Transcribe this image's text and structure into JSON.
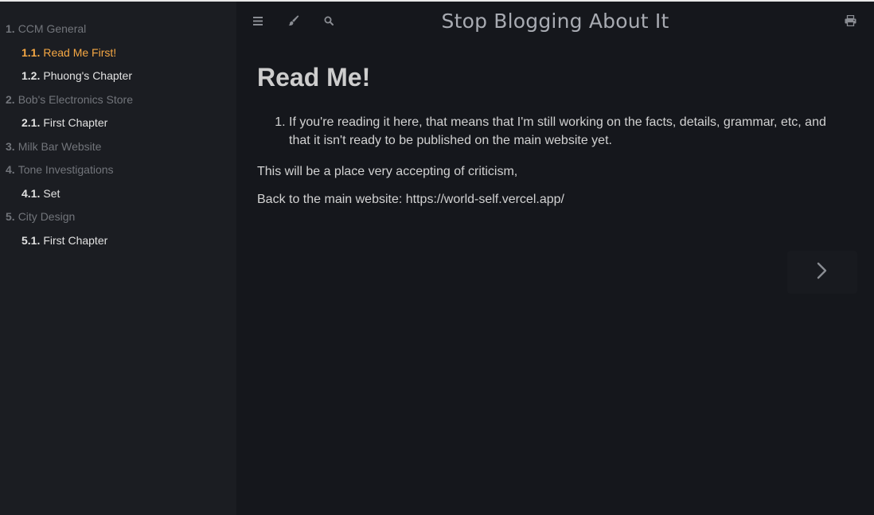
{
  "sidebar": {
    "items": [
      {
        "num": "1.",
        "label": "CCM General",
        "kind": "section"
      },
      {
        "num": "1.1.",
        "label": "Read Me First!",
        "kind": "chapter",
        "active": true
      },
      {
        "num": "1.2.",
        "label": "Phuong's Chapter",
        "kind": "chapter"
      },
      {
        "num": "2.",
        "label": "Bob's Electronics Store",
        "kind": "section"
      },
      {
        "num": "2.1.",
        "label": "First Chapter",
        "kind": "chapter"
      },
      {
        "num": "3.",
        "label": "Milk Bar Website",
        "kind": "section"
      },
      {
        "num": "4.",
        "label": "Tone Investigations",
        "kind": "section"
      },
      {
        "num": "4.1.",
        "label": "Set",
        "kind": "chapter"
      },
      {
        "num": "5.",
        "label": "City Design",
        "kind": "section"
      },
      {
        "num": "5.1.",
        "label": "First Chapter",
        "kind": "chapter"
      }
    ]
  },
  "menubar": {
    "title": "Stop Blogging About It",
    "icons": [
      "menu-icon",
      "paintbrush-icon",
      "search-icon",
      "print-icon"
    ]
  },
  "content": {
    "heading": "Read Me!",
    "list_item_1": "If you're reading it here, that means that I'm still working on the facts, details, grammar, etc, and that it isn't ready to be published on the main website yet.",
    "paragraph_1": "This will be a place very accepting of criticism,",
    "paragraph_2_prefix": "Back to the main website: ",
    "paragraph_2_link": "https://world-self.vercel.app/"
  },
  "navigation": {
    "next_icon": "chevron-right-icon"
  },
  "colors": {
    "background": "#15171c",
    "sidebar": "#1b1d22",
    "active": "#f6a844",
    "section_text": "#72757b",
    "chapter_text": "#e2e2e2"
  }
}
